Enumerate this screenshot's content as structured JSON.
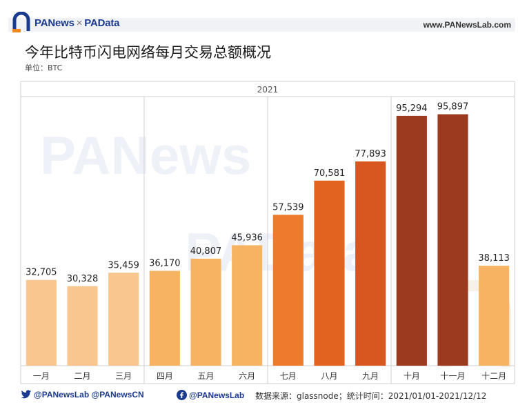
{
  "header": {
    "brand_pa": "PANews",
    "brand_sep": "×",
    "brand_pad": "PAData",
    "site": "www.PANewsLab.com"
  },
  "title": "今年比特币闪电网络每月交易总额概况",
  "subtitle": "单位：BTC",
  "watermarks": [
    "PANews",
    "PAData"
  ],
  "chart_data": {
    "type": "bar",
    "year_label": "2021",
    "categories": [
      "一月",
      "二月",
      "三月",
      "四月",
      "五月",
      "六月",
      "七月",
      "八月",
      "九月",
      "十月",
      "十一月",
      "十二月"
    ],
    "values": [
      32705,
      30328,
      35459,
      36170,
      40807,
      45936,
      57539,
      70581,
      77893,
      95294,
      95897,
      38113
    ],
    "value_labels": [
      "32,705",
      "30,328",
      "35,459",
      "36,170",
      "40,807",
      "45,936",
      "57,539",
      "70,581",
      "77,893",
      "95,294",
      "95,897",
      "38,113"
    ],
    "colors": [
      "#f8c68e",
      "#f8c68e",
      "#f8c68e",
      "#f6b463",
      "#f6b463",
      "#f6b463",
      "#ee7a2c",
      "#e2621f",
      "#d8571e",
      "#9b3a1f",
      "#9b3a1f",
      "#f6b463"
    ],
    "quarter_boundaries_after": [
      2,
      5,
      8
    ],
    "ylim": [
      0,
      100000
    ],
    "grid": false
  },
  "footer": {
    "twitter": "@PANewsLab  @PANewsCN",
    "facebook": "@PANewsLab",
    "source": "数据来源：glassnode；统计时间：2021/01/01-2021/12/12"
  },
  "colors": {
    "brand_blue": "#1a3a8f",
    "frame": "#cfcfcf",
    "header_bg": "#f1f2f5"
  }
}
